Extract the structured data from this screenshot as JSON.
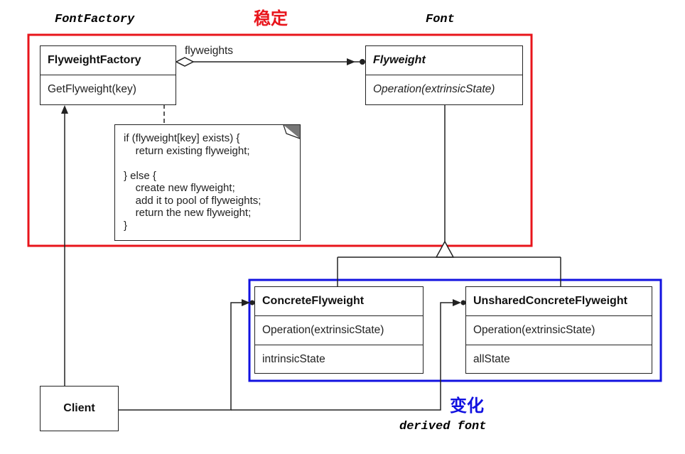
{
  "labels": {
    "top_left": "FontFactory",
    "top_center": "稳定",
    "top_right": "Font",
    "bottom_cjk": "变化",
    "bottom_mono": "derived font"
  },
  "colors": {
    "stable": "#e8141b",
    "variable": "#1212e0"
  },
  "classes": {
    "factory": {
      "name": "FlyweightFactory",
      "operation": "GetFlyweight(key)"
    },
    "flyweight": {
      "name": "Flyweight",
      "operation": "Operation(extrinsicState)"
    },
    "concrete": {
      "name": "ConcreteFlyweight",
      "operation": "Operation(extrinsicState)",
      "attribute": "intrinsicState"
    },
    "unshared": {
      "name": "UnsharedConcreteFlyweight",
      "operation": "Operation(extrinsicState)",
      "attribute": "allState"
    },
    "client": {
      "name": "Client"
    }
  },
  "association_label": "flyweights",
  "note_lines": [
    "if (flyweight[key] exists) {",
    "    return existing flyweight;",
    "",
    "} else {",
    "    create new flyweight;",
    "    add it to pool of flyweights;",
    "    return the new flyweight;",
    "}"
  ]
}
